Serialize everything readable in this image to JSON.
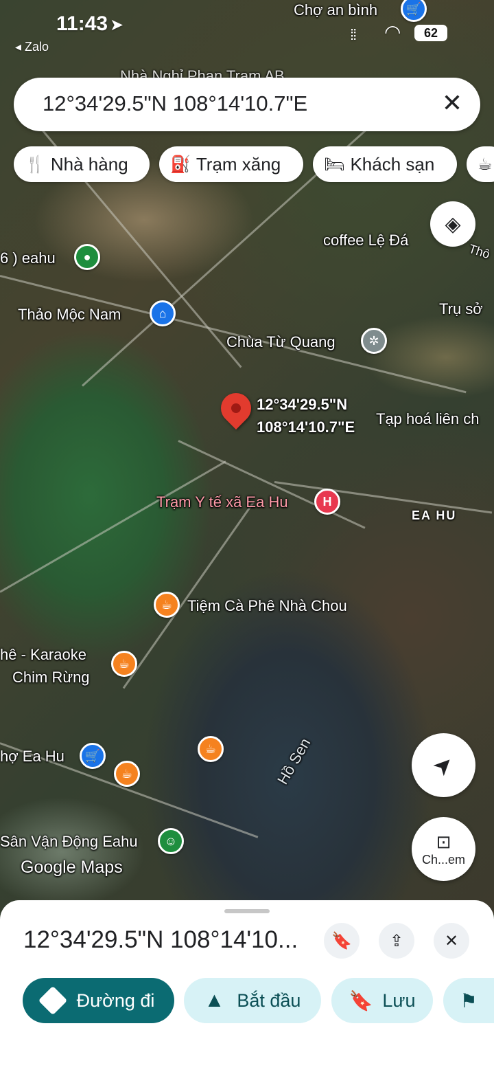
{
  "status_bar": {
    "time": "11:43",
    "back_app": "Zalo",
    "battery": "62"
  },
  "search": {
    "query": "12°34'29.5\"N 108°14'10.7\"E"
  },
  "chips": [
    {
      "label": "Nhà hàng",
      "icon": "restaurant-icon"
    },
    {
      "label": "Trạm xăng",
      "icon": "gas-station-icon"
    },
    {
      "label": "Khách sạn",
      "icon": "hotel-icon"
    }
  ],
  "map": {
    "places": {
      "cho_an_binh": "Chợ an bình",
      "nha_nghi": "Nhà Nghỉ Phan Trạm AB",
      "coffee_le_da": "coffee Lệ Đá",
      "tho": "Thô",
      "eahu": "6 ) eahu",
      "thao_moc_nam": "Thảo Mộc Nam",
      "tru_so": "Trụ sở",
      "chua_tu_quang": "Chùa Từ Quang",
      "tap_hoa": "Tạp hoá liên ch",
      "tram_y_te": "Trạm Y tế xã Ea Hu",
      "ea_hu_area": "EA HU",
      "tiem_ca_phe": "Tiệm Cà Phê Nhà Chou",
      "karaoke_line1": "hê - Karaoke",
      "karaoke_line2": "Chim Rừng",
      "cho_ea_hu": "hợ Ea Hu",
      "ho_sen": "Hồ Sen",
      "san_van_dong": "Sân Vận Động Eahu",
      "watermark": "Google Maps"
    },
    "pin_label_line1": "12°34'29.5\"N",
    "pin_label_line2": "108°14'10.7\"E",
    "camera_btn_label": "Ch...em"
  },
  "sheet": {
    "title": "12°34'29.5\"N 108°14'10...",
    "buttons": {
      "directions": "Đường đi",
      "start": "Bắt đầu",
      "save": "Lưu"
    }
  },
  "colors": {
    "accent_dark": "#0b6b72",
    "accent_light": "#d7f2f6",
    "pin_red": "#e23b2e",
    "food_orange": "#f5821f",
    "shop_blue": "#1a73e8",
    "health_red": "#e8384f",
    "green_poi": "#1e8e3e"
  }
}
